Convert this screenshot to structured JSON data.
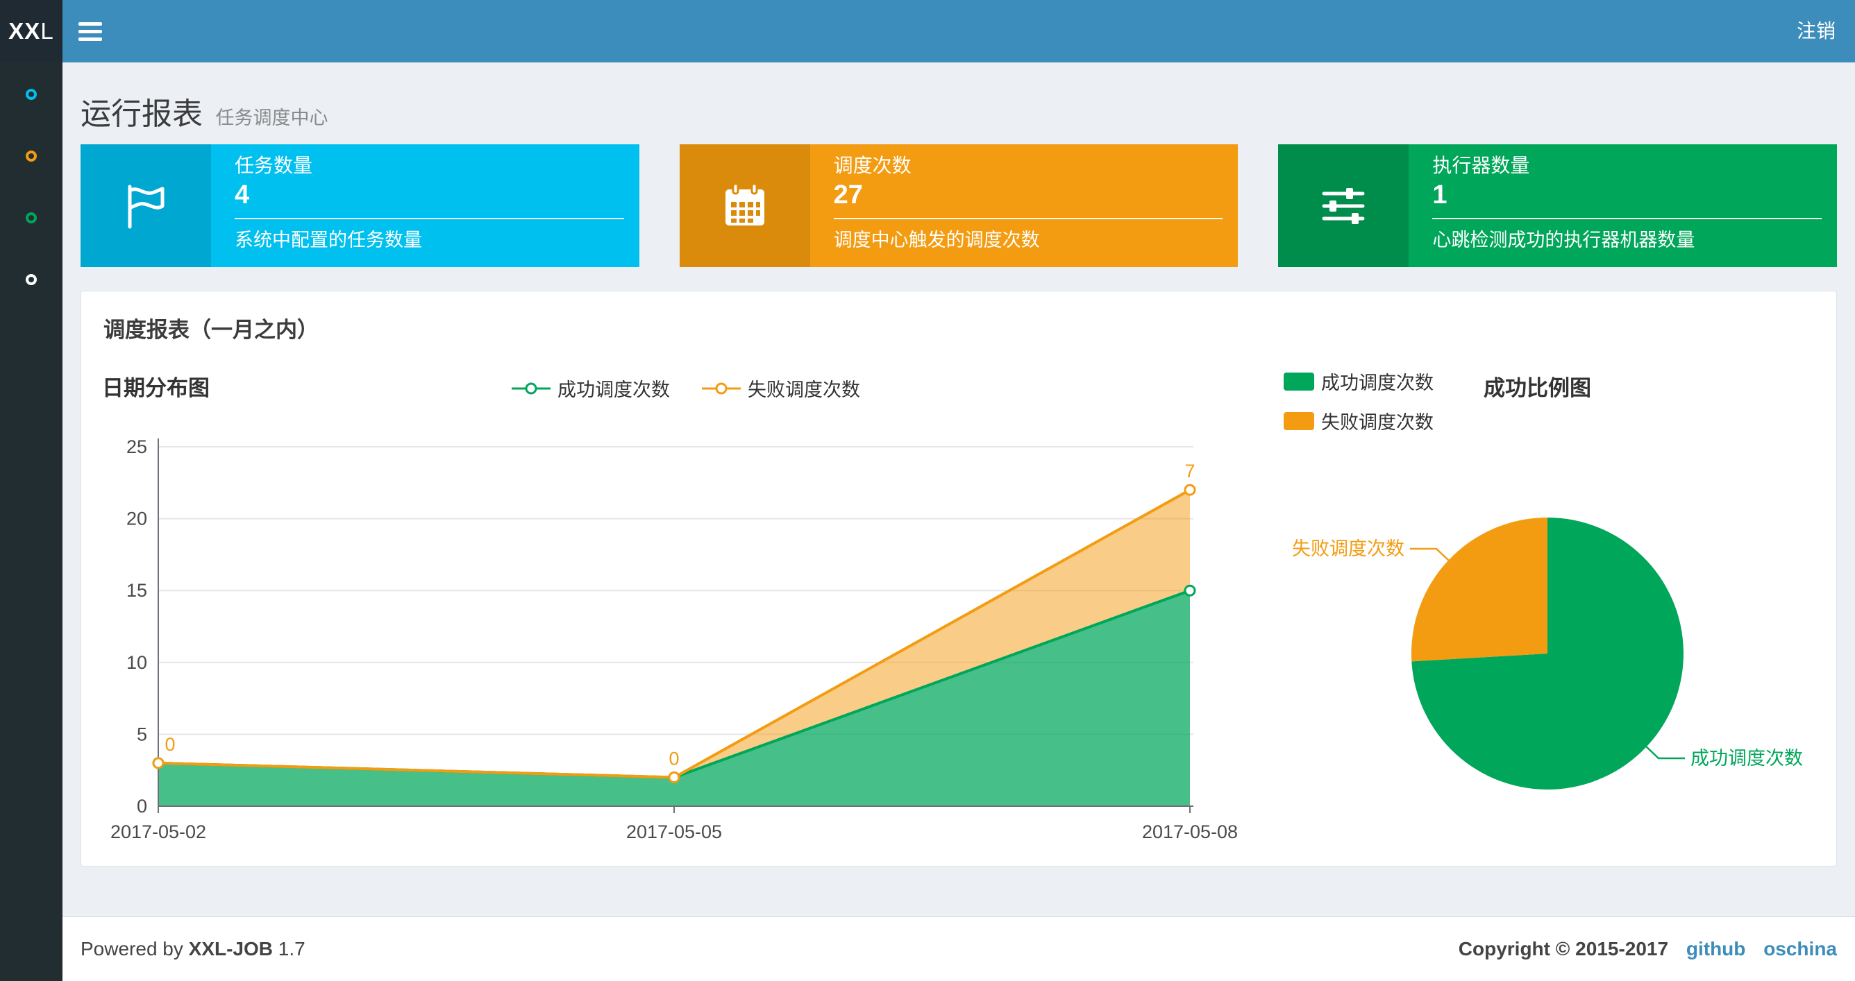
{
  "navbar": {
    "logo_bold": "XX",
    "logo_light": "L",
    "logout_label": "注销"
  },
  "sidebar": {
    "items": [
      {
        "icon": "circle-outline-icon",
        "color": "#00c0ef"
      },
      {
        "icon": "circle-outline-icon",
        "color": "#f39c12"
      },
      {
        "icon": "circle-outline-icon",
        "color": "#00a65a"
      },
      {
        "icon": "circle-outline-icon",
        "color": "#ffffff"
      }
    ]
  },
  "page": {
    "title": "运行报表",
    "subtitle": "任务调度中心"
  },
  "info_boxes": [
    {
      "icon": "flag-icon",
      "label": "任务数量",
      "value": "4",
      "desc": "系统中配置的任务数量",
      "bg": "#00c0ef",
      "icon_bg": "#00a7d0"
    },
    {
      "icon": "calendar-icon",
      "label": "调度次数",
      "value": "27",
      "desc": "调度中心触发的调度次数",
      "bg": "#f39c12",
      "icon_bg": "#db8b0b"
    },
    {
      "icon": "sliders-icon",
      "label": "执行器数量",
      "value": "1",
      "desc": "心跳检测成功的执行器机器数量",
      "bg": "#00a65a",
      "icon_bg": "#008d4c"
    }
  ],
  "panel": {
    "title": "调度报表（一月之内）"
  },
  "chart_data": [
    {
      "type": "area",
      "title": "日期分布图",
      "x": [
        "2017-05-02",
        "2017-05-05",
        "2017-05-08"
      ],
      "series": [
        {
          "name": "成功调度次数",
          "values": [
            3,
            2,
            15
          ],
          "color": "#00A65A"
        },
        {
          "name": "失败调度次数",
          "values": [
            0,
            0,
            7
          ],
          "color": "#F39C12"
        }
      ],
      "stacked": true,
      "point_labels_series": "失败调度次数",
      "point_labels": [
        "0",
        "0",
        "7"
      ],
      "ylim": [
        0,
        25
      ],
      "yticks": [
        0,
        5,
        10,
        15,
        20,
        25
      ],
      "grid": true,
      "legend_position": "top-center"
    },
    {
      "type": "pie",
      "title": "成功比例图",
      "labels": [
        "成功调度次数",
        "失败调度次数"
      ],
      "values": [
        20,
        7
      ],
      "colors": [
        "#00A65A",
        "#F39C12"
      ],
      "legend_position": "top-left",
      "start_angle": "top",
      "direction": "clockwise"
    }
  ],
  "footer": {
    "powered_prefix": "Powered by",
    "product": "XXL-JOB",
    "version": "1.7",
    "copyright": "Copyright © 2015-2017",
    "links": [
      "github",
      "oschina"
    ]
  }
}
